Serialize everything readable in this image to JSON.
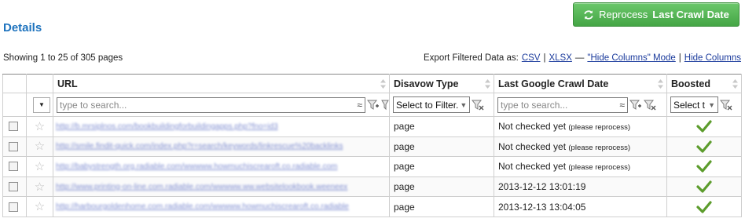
{
  "header": {
    "reprocess_button": {
      "label_regular": "Reprocess",
      "label_bold": "Last Crawl Date"
    },
    "title": "Details"
  },
  "summary": {
    "showing": "Showing 1 to 25 of 305 pages",
    "export_label": "Export Filtered Data as:",
    "csv": "CSV",
    "sep1": "|",
    "xlsx": "XLSX",
    "dash": "—",
    "hide_columns_mode": "\"Hide Columns\" Mode",
    "sep2": "|",
    "hide_columns": "Hide Columns"
  },
  "table": {
    "columns": {
      "url": "URL",
      "disavow": "Disavow Type",
      "crawl": "Last Google Crawl Date",
      "boosted": "Boosted"
    },
    "filters": {
      "url_placeholder": "type to search...",
      "approx_symbol": "≈",
      "disavow_select": "Select to Filter.",
      "crawl_placeholder": "type to search...",
      "boosted_select": "Select t"
    },
    "rows": [
      {
        "url": "http://b.mrsiplnos.com/bookbuildingforbuildingapps.php?fno=id3",
        "disavow": "page",
        "crawl": "Not checked yet",
        "crawl_note": "(please reprocess)",
        "boosted": true
      },
      {
        "url": "http://smile.findit-quick.com/index.php?r=search/keywords/linkrescue%20backlinks",
        "disavow": "page",
        "crawl": "Not checked yet",
        "crawl_note": "(please reprocess)",
        "boosted": true
      },
      {
        "url": "http://babystrength.org.radiable.com/wwwww.howmuchiscrearoft.co.radiable.com",
        "disavow": "page",
        "crawl": "Not checked yet",
        "crawl_note": "(please reprocess)",
        "boosted": true
      },
      {
        "url": "http://www.printing-on-line.com.radiable.com/wwwww.ww.websitelookbook.weeneex",
        "disavow": "page",
        "crawl": "2013-12-12 13:01:19",
        "crawl_note": "",
        "boosted": true
      },
      {
        "url": "http://harbourgoldenhome.com.radiable.com/wwwww.howmuchiscrearoft.co.radiable",
        "disavow": "page",
        "crawl": "2013-12-13 13:04:05",
        "crawl_note": "",
        "boosted": true
      }
    ]
  },
  "colors": {
    "accent": "#1e73be",
    "button_green": "#44a545",
    "check_green": "#5c9c2c",
    "link": "#1a3a9c"
  },
  "icons": {
    "reprocess": "refresh-icon",
    "funnel": "filter-funnel-icon",
    "star": "star-icon",
    "check": "checkmark-icon"
  }
}
